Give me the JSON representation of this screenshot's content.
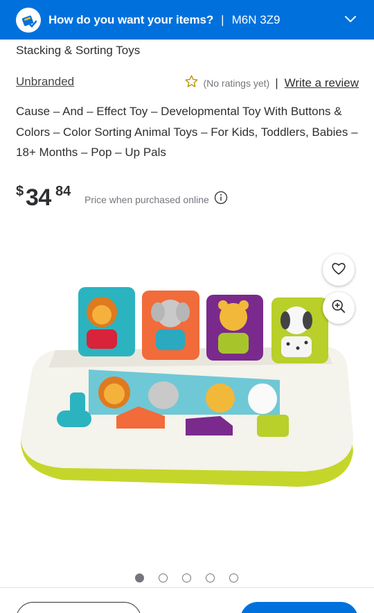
{
  "header": {
    "title": "How do you want your items?",
    "separator": "|",
    "postal_code": "M6N 3Z9",
    "icons": {
      "store": "store-pickup-icon",
      "chevron": "chevron-down-icon"
    },
    "bg_color": "#0071dc"
  },
  "product": {
    "category": "Stacking & Sorting Toys",
    "brand": "Unbranded",
    "rating_text": "(No ratings yet)",
    "rating_separator": "|",
    "write_review": "Write a review",
    "title": "Cause – And – Effect Toy – Developmental Toy With Buttons & Colors – Color Sorting Animal Toys – For Kids, Toddlers, Babies – 18+ Months – Pop – Up Pals",
    "price": {
      "currency": "$",
      "dollars": "34",
      "cents": "84"
    },
    "price_note": "Price when purchased online"
  },
  "gallery": {
    "image_count": 5,
    "active_index": 0,
    "icons": {
      "favorite": "heart-icon",
      "zoom": "zoom-in-icon",
      "info": "info-icon",
      "rating": "star-outline-icon"
    }
  },
  "colors": {
    "accent": "#0071dc",
    "text": "#2e2f32",
    "muted": "#74767c",
    "star": "#b8930a"
  }
}
